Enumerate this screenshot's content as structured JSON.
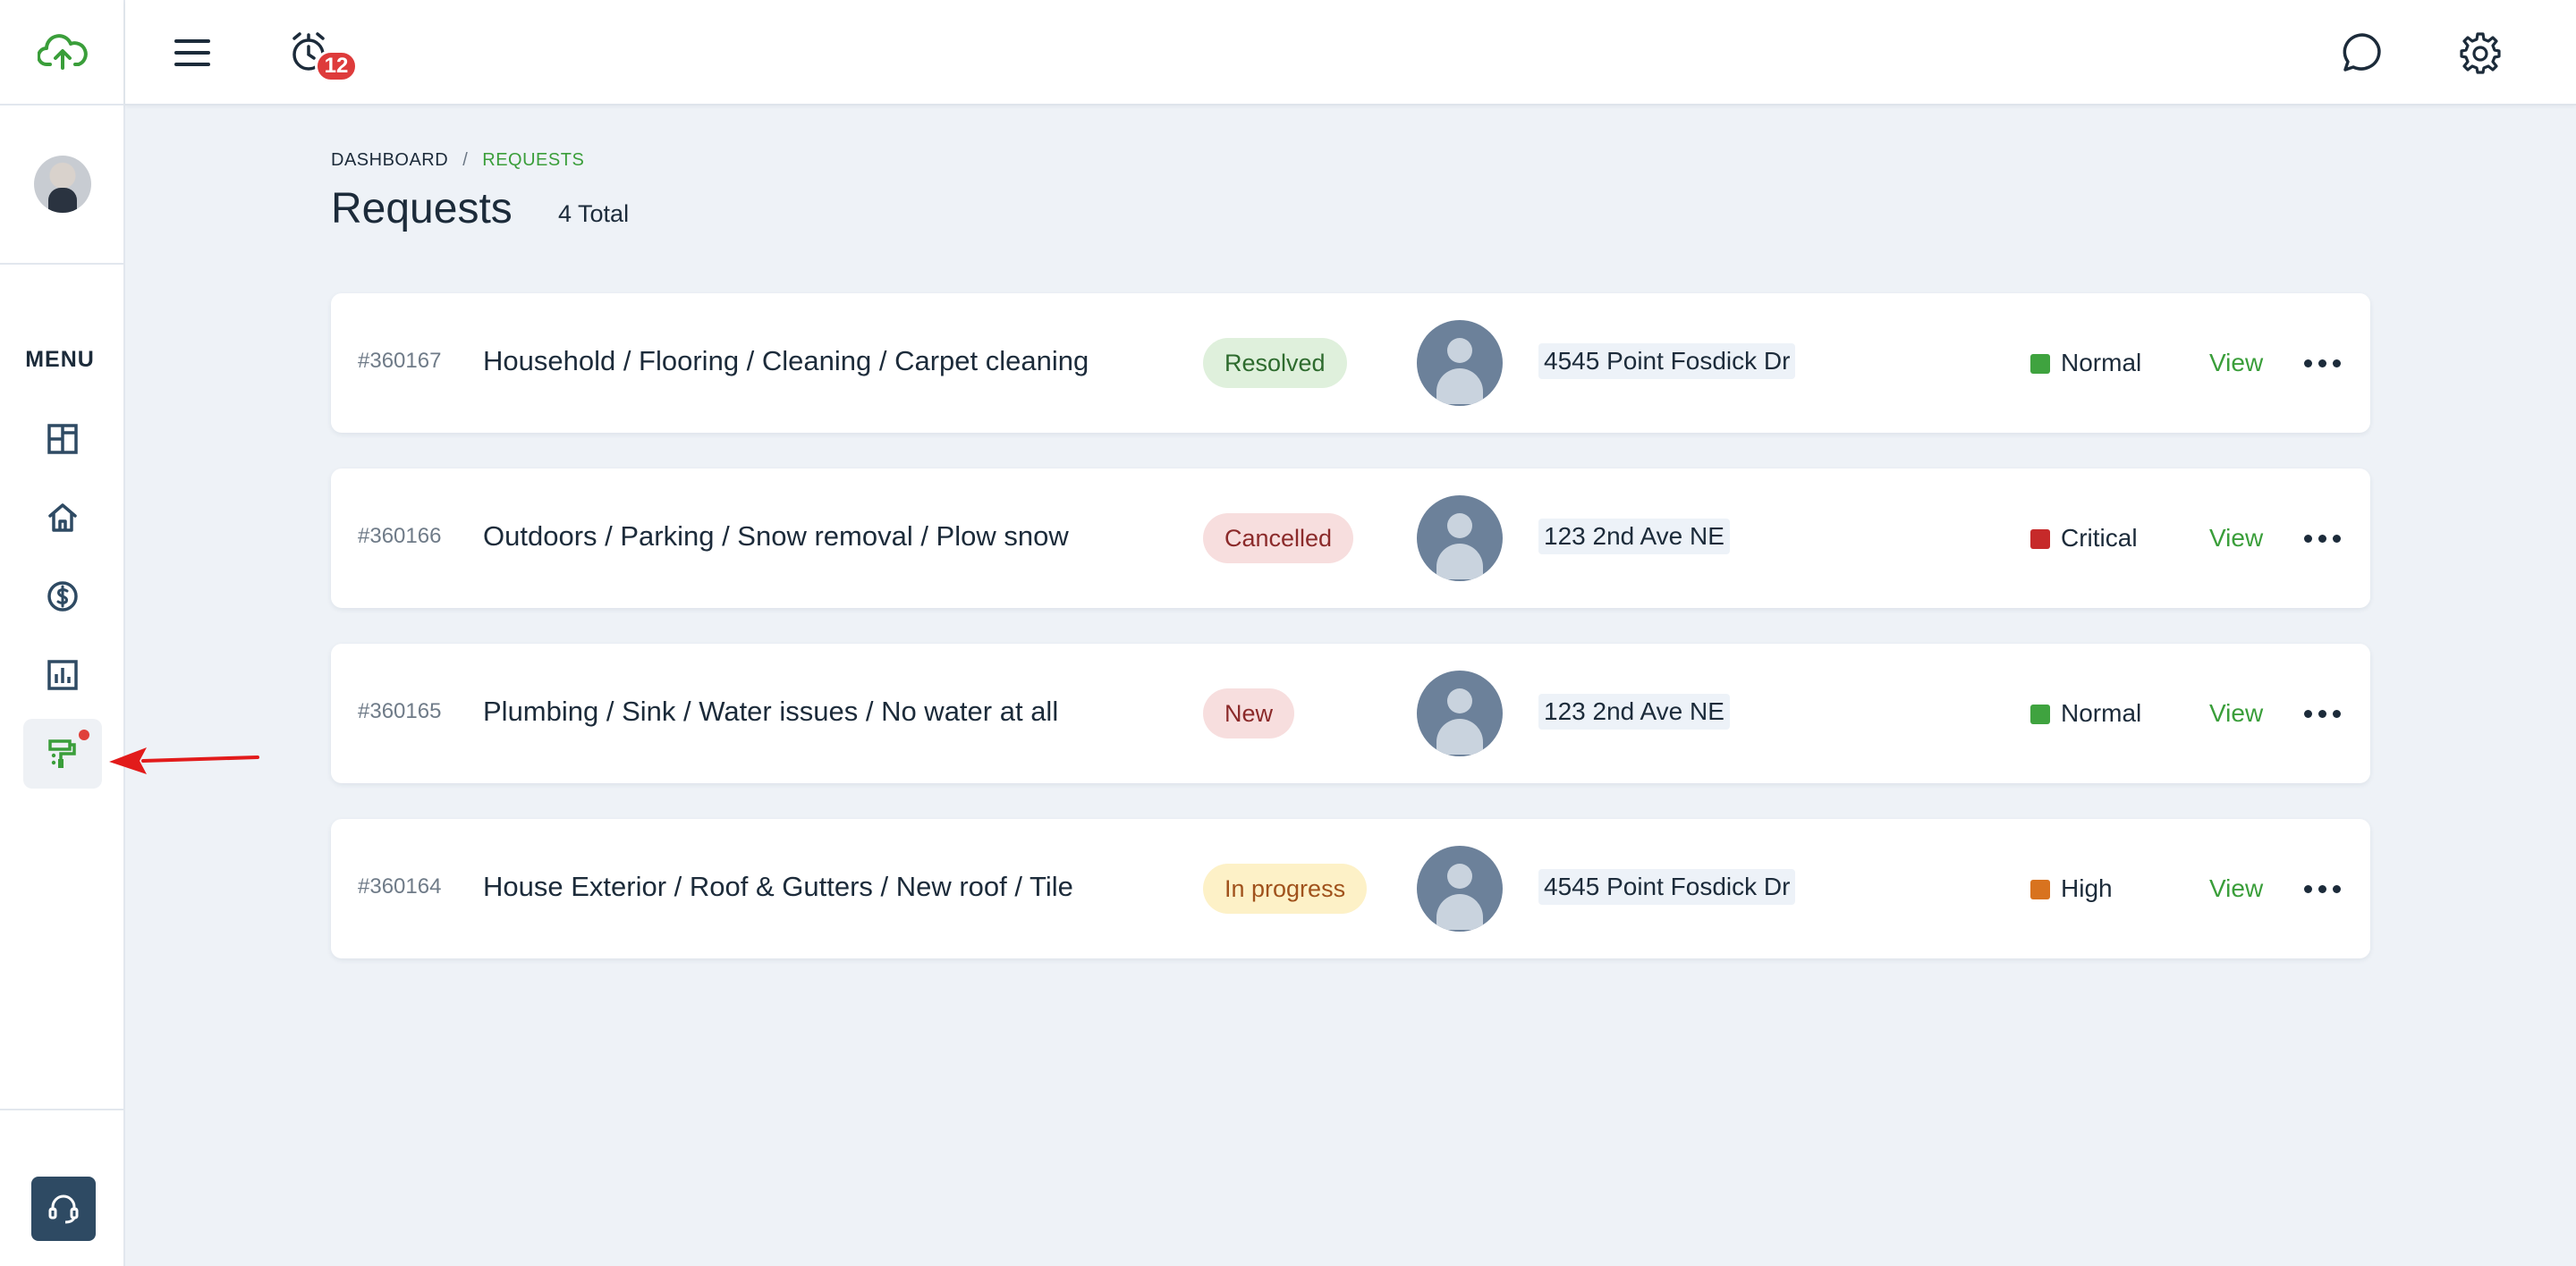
{
  "app": {
    "logo_icon": "cloud-upload-icon",
    "notifications_count": "12",
    "brand_color": "#3a9e3a"
  },
  "sidebar": {
    "menu_label": "MENU",
    "items": [
      {
        "icon": "dashboard-icon"
      },
      {
        "icon": "home-icon"
      },
      {
        "icon": "dollar-icon"
      },
      {
        "icon": "chart-icon"
      },
      {
        "icon": "paint-roller-icon",
        "active": true,
        "has_dot": true
      }
    ],
    "support_icon": "headset-icon"
  },
  "topbar": {
    "menu_icon": "hamburger-icon",
    "alarm_icon": "alarm-clock-icon",
    "chat_icon": "chat-icon",
    "settings_icon": "gear-icon"
  },
  "breadcrumb": {
    "root": "DASHBOARD",
    "separator": "/",
    "current": "REQUESTS"
  },
  "page": {
    "title": "Requests",
    "total": "4 Total"
  },
  "requests": [
    {
      "id": "#360167",
      "title": "Household / Flooring / Cleaning / Carpet cleaning",
      "status": "Resolved",
      "status_bg": "#dff0dc",
      "status_fg": "#2e6b2e",
      "address": "4545 Point Fosdick Dr",
      "priority": "Normal",
      "priority_color": "#3fa33f",
      "view": "View"
    },
    {
      "id": "#360166",
      "title": "Outdoors / Parking / Snow removal / Plow snow",
      "status": "Cancelled",
      "status_bg": "#f7dede",
      "status_fg": "#8b2a2a",
      "address": "123 2nd Ave NE",
      "priority": "Critical",
      "priority_color": "#c62a2a",
      "view": "View"
    },
    {
      "id": "#360165",
      "title": "Plumbing / Sink / Water issues / No water at all",
      "status": "New",
      "status_bg": "#f7dede",
      "status_fg": "#8b2a2a",
      "address": "123 2nd Ave NE",
      "priority": "Normal",
      "priority_color": "#3fa33f",
      "view": "View"
    },
    {
      "id": "#360164",
      "title": "House Exterior / Roof & Gutters / New roof / Tile",
      "status": "In progress",
      "status_bg": "#fdf1c7",
      "status_fg": "#a0521c",
      "address": "4545 Point Fosdick Dr",
      "priority": "High",
      "priority_color": "#d8731f",
      "view": "View"
    }
  ]
}
